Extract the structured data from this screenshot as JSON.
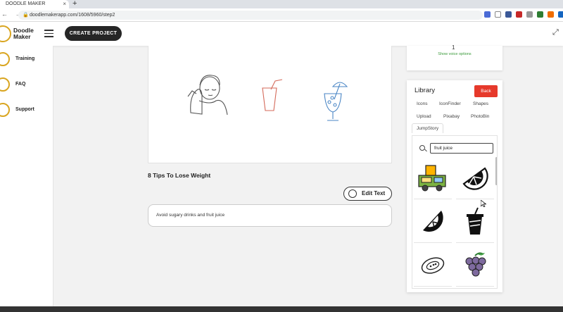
{
  "browser": {
    "tab_title": "DOODLE MAKER",
    "tab_close": "×",
    "new_tab": "+",
    "nav": "← → ↻",
    "lock": "🔒",
    "url": "doodlemakerapp.com/1608/5960/step2"
  },
  "header": {
    "logo_line1": "Doodle",
    "logo_line2": "Maker",
    "create_label": "CREATE PROJECT",
    "expand_glyph": "⤢"
  },
  "sidebar": {
    "items": [
      {
        "label": "Training"
      },
      {
        "label": "FAQ"
      },
      {
        "label": "Support"
      }
    ]
  },
  "scene": {
    "title": "8 Tips To Lose Weight",
    "edit_label": "Edit Text",
    "text": "Avoid sugary drinks and fruit juice"
  },
  "voice": {
    "number": "1",
    "link": "Show voice options"
  },
  "library": {
    "title": "Library",
    "back_label": "Back",
    "tabs": [
      "Icons",
      "IconFinder",
      "Shapes",
      "Upload",
      "Pixabay",
      "PhotoBin",
      "JumpStory"
    ],
    "active_tab": "JumpStory",
    "search_value": "fruit juice",
    "results": [
      "food-truck-icon",
      "orange-slice-icon",
      "orange-slice-black-icon",
      "juice-cup-icon",
      "papaya-icon",
      "grapes-icon"
    ]
  },
  "colors": {
    "accent_gold": "#d9a520",
    "back_red": "#e6392b",
    "dark_button": "#262626",
    "voice_link": "#3a9a3a"
  }
}
